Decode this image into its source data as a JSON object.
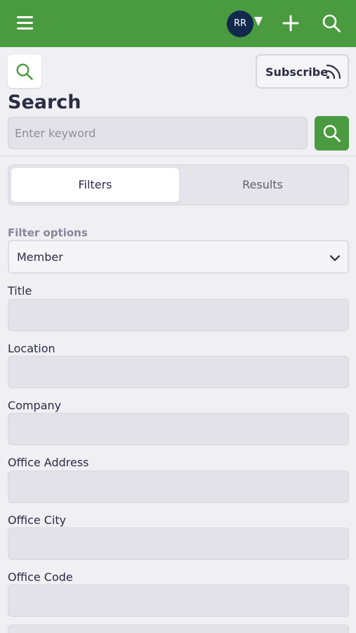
{
  "topbar": {
    "menu_icon": "hamburger-menu-icon",
    "avatar_initials": "RR",
    "add_icon": "plus-icon",
    "search_icon": "search-icon",
    "brand_color": "#4a9a40"
  },
  "header": {
    "title": "Search",
    "subscribe_label": "Subscribe",
    "rss_icon": "rss-icon"
  },
  "search": {
    "placeholder": "Enter keyword",
    "value": ""
  },
  "tabs": [
    {
      "label": "Filters",
      "active": true
    },
    {
      "label": "Results",
      "active": false
    }
  ],
  "filters": {
    "options_label": "Filter options",
    "selected_option": "Member",
    "fields": [
      {
        "label": "Title",
        "value": ""
      },
      {
        "label": "Location",
        "value": ""
      },
      {
        "label": "Company",
        "value": ""
      },
      {
        "label": "Office Address",
        "value": ""
      },
      {
        "label": "Office City",
        "value": ""
      },
      {
        "label": "Office Code",
        "value": ""
      }
    ]
  }
}
